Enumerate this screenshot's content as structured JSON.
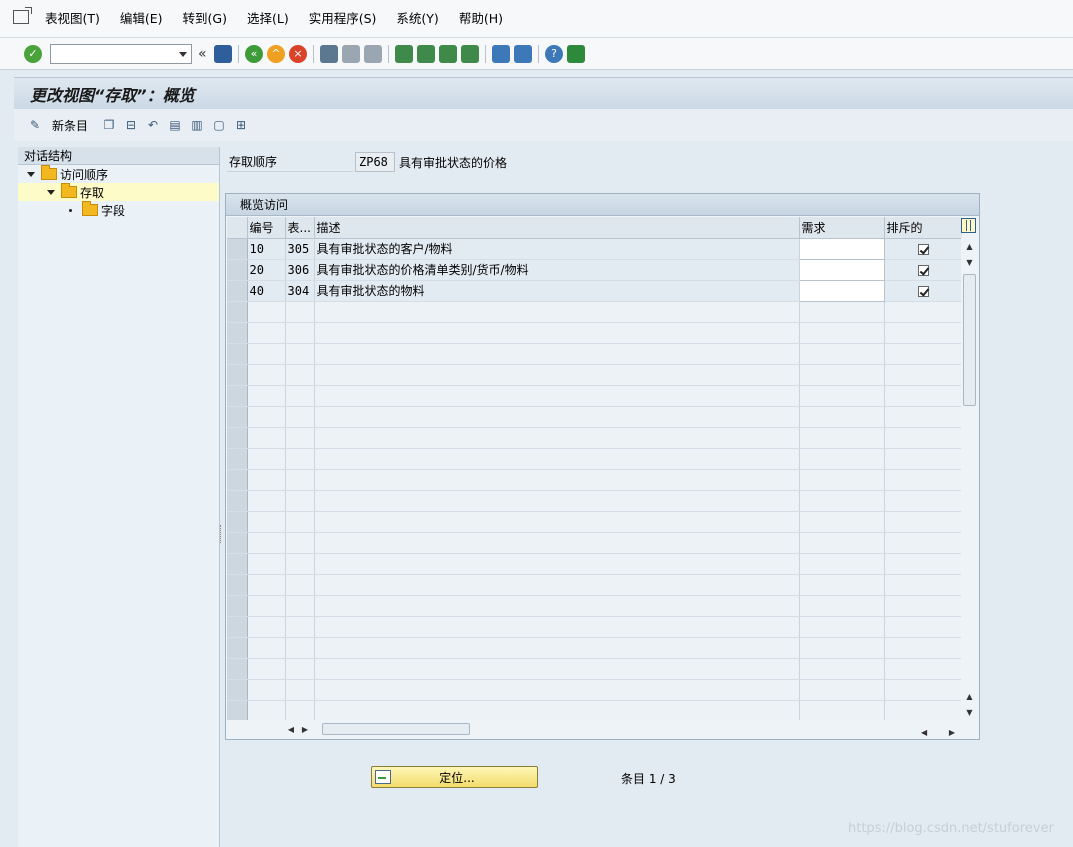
{
  "menubar": {
    "items": [
      "表视图(T)",
      "编辑(E)",
      "转到(G)",
      "选择(L)",
      "实用程序(S)",
      "系统(Y)",
      "帮助(H)"
    ]
  },
  "toolbar": {
    "command_value": "",
    "back_chevron": "«"
  },
  "title": "更改视图“存取”：概览",
  "apptoolbar": {
    "new_entries": "新条目"
  },
  "left_panel": {
    "header": "对话结构",
    "nodes": [
      {
        "label": "访问顺序",
        "level": 0
      },
      {
        "label": "存取",
        "level": 1,
        "selected": true
      },
      {
        "label": "字段",
        "level": 2
      }
    ]
  },
  "header_field": {
    "label": "存取顺序",
    "value": "ZP68",
    "description": "具有审批状态的价格"
  },
  "table": {
    "title": "概览访问",
    "columns": [
      "编号",
      "表...",
      "描述",
      "需求",
      "排斥的"
    ],
    "rows": [
      {
        "no": "10",
        "table": "305",
        "desc": "具有审批状态的客户/物料",
        "req": "",
        "excl": true
      },
      {
        "no": "20",
        "table": "306",
        "desc": "具有审批状态的价格清单类别/货币/物料",
        "req": "",
        "excl": true
      },
      {
        "no": "40",
        "table": "304",
        "desc": "具有审批状态的物料",
        "req": "",
        "excl": true
      }
    ],
    "empty_rows": 20
  },
  "footer": {
    "position_button": "定位...",
    "entry_counter": "条目 1 / 3"
  },
  "watermark": "https://blog.csdn.net/stuforever"
}
